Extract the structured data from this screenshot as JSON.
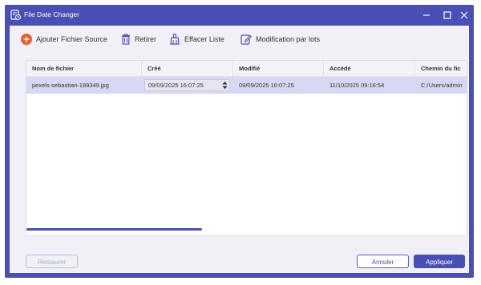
{
  "window": {
    "title": "File Date Changer"
  },
  "toolbar": {
    "add_label": "Ajouter Fichier Source",
    "remove_label": "Retirer",
    "clear_label": "Effacer Liste",
    "batch_label": "Modification par lots"
  },
  "table": {
    "headers": [
      "Nom de fichier",
      "Créé",
      "Modifié",
      "Accédé",
      "Chemin du fic"
    ],
    "rows": [
      {
        "name": "pexels-sebastian-189349.jpg",
        "created": "09/09/2025 16:07:25",
        "modified": "09/09/2025 16:07:25",
        "accessed": "11/10/2025 09:16:54",
        "path": "C:/Users/admin"
      }
    ]
  },
  "footer": {
    "restore_label": "Restaurer",
    "cancel_label": "Annuler",
    "apply_label": "Appliquer"
  },
  "colors": {
    "accent": "#4a4fb5",
    "add_icon": "#f05a28",
    "selected_row": "#d7d8f4"
  }
}
